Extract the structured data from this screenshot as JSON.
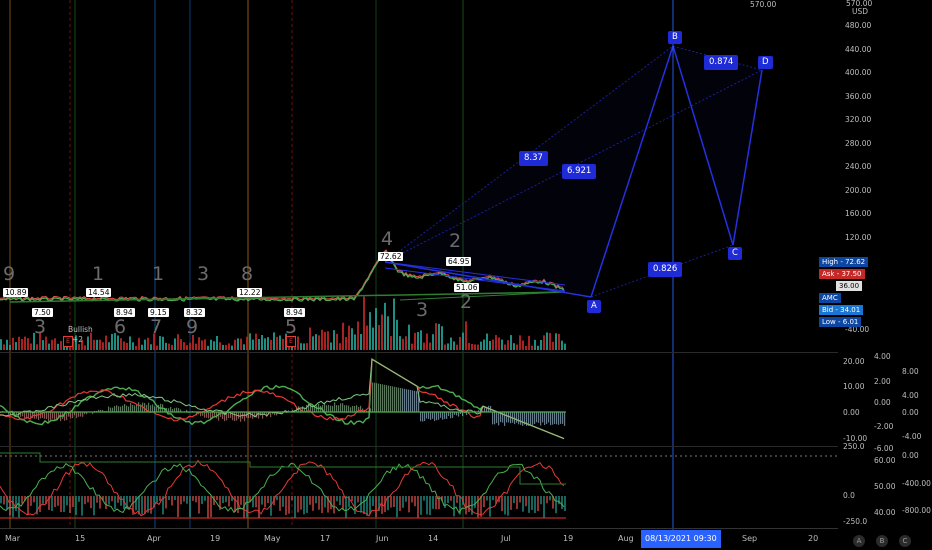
{
  "price_axis": {
    "currency": "USD",
    "top_label": "570.00",
    "ticks": [
      "480.00",
      "440.00",
      "400.00",
      "360.00",
      "320.00",
      "280.00",
      "240.00",
      "200.00",
      "160.00",
      "120.00",
      "-40.00"
    ],
    "badges": {
      "high": "High - 72.62",
      "ask": "Ask - 37.50",
      "last": "36.00",
      "symbol": "AMC",
      "bid": "Bid - 34.01",
      "low": "Low - 6.01"
    }
  },
  "osc1_axis": {
    "inner": [
      "20.00",
      "10.00",
      "0.00",
      "-10.00"
    ],
    "outer_top": "4.00",
    "outer": [
      "8.00",
      "2.00",
      "4.00",
      "0.00",
      "0.00",
      "-2.00",
      "-4.00",
      "-6.00"
    ]
  },
  "osc2_axis": {
    "inner": [
      "250.0",
      "0.0",
      "-250.0"
    ],
    "outer": [
      "60.00",
      "0.00",
      "50.00",
      "-400.00",
      "-800.00",
      "40.00"
    ]
  },
  "time_axis": {
    "labels": [
      "Mar",
      "15",
      "Apr",
      "19",
      "May",
      "17",
      "Jun",
      "14",
      "Jul",
      "19",
      "Aug",
      "Sep",
      "20"
    ],
    "crosshair_date": "08/13/2021  09:30"
  },
  "price_tags": [
    "10.89",
    "7.50",
    "14.54",
    "8.94",
    "9.15",
    "8.32",
    "12.22",
    "8.94",
    "72.62",
    "64.95",
    "51.06"
  ],
  "wave_labels": [
    "9",
    "3",
    "1",
    "6",
    "1",
    "7",
    "3",
    "9",
    "8",
    "5",
    "4",
    "3",
    "2",
    "2"
  ],
  "bullish_note": {
    "text": "Bullish",
    "value": "+2"
  },
  "pattern": {
    "points": [
      "A",
      "B",
      "C",
      "D"
    ],
    "ratios": [
      "8.37",
      "6.921",
      "0.874",
      "0.826"
    ]
  },
  "bottom_buttons": [
    "A",
    "B",
    "C"
  ],
  "colors": {
    "background": "#000000",
    "pattern": "#2531e0",
    "bull": "#26a69a",
    "bear": "#ef5350",
    "green_line": "#4caf50",
    "red_line": "#e53935",
    "crosshair": "#2962ff"
  }
}
